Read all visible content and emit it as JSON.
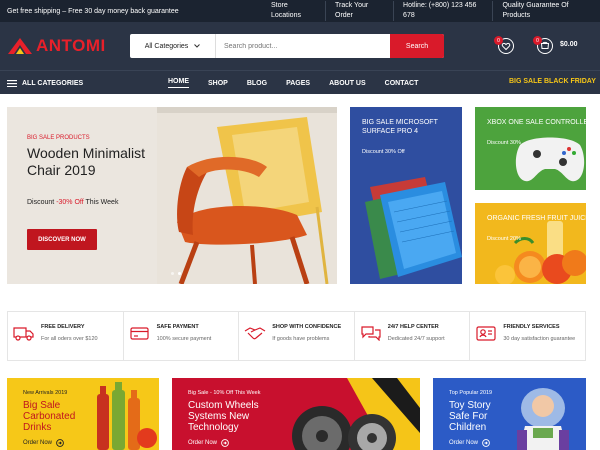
{
  "topbar": {
    "promo": "Get free shipping – Free 30 day money back guarantee",
    "links": [
      "Store Locations",
      "Track Your Order",
      "Hotline: (+800) 123 456 678",
      "Quality Guarantee Of Products"
    ]
  },
  "header": {
    "logo": "ANTOMI",
    "category": "All Categories",
    "search_placeholder": "Search product...",
    "search_button": "Search",
    "wishlist_count": "0",
    "cart_count": "0",
    "cart_total": "$0.00"
  },
  "nav": {
    "all_categories": "ALL CATEGORIES",
    "items": [
      "HOME",
      "SHOP",
      "BLOG",
      "PAGES",
      "ABOUT US",
      "CONTACT"
    ],
    "promo": "BIG SALE BLACK FRIDAY"
  },
  "hero": {
    "label": "BIG SALE PRODUCTS",
    "title": "Wooden Minimalist Chair 2019",
    "discount_prefix": "Discount",
    "discount_value": "-30% Off",
    "discount_suffix": "This Week",
    "button": "DISCOVER NOW"
  },
  "promos": [
    {
      "title": "BIG SALE MICROSOFT SURFACE PRO 4",
      "sub": "Discount 30% Off"
    },
    {
      "title": "XBOX ONE SALE CONTROLLER",
      "sub": "Discount 30%"
    },
    {
      "title": "ORGANIC FRESH FRUIT JUICE",
      "sub": "Discount 20%"
    }
  ],
  "features": [
    {
      "title": "FREE DELIVERY",
      "sub": "For all oders over $120"
    },
    {
      "title": "SAFE PAYMENT",
      "sub": "100% secure payment"
    },
    {
      "title": "SHOP WITH CONFIDENCE",
      "sub": "If goods have problems"
    },
    {
      "title": "24/7 HELP CENTER",
      "sub": "Dedicated 24/7 support"
    },
    {
      "title": "FRIENDLY SERVICES",
      "sub": "30 day satisfaction guarantee"
    }
  ],
  "banners": [
    {
      "sub": "New Arrivals 2019",
      "title": "Big Sale Carbonated Drinks",
      "link": "Order Now"
    },
    {
      "sub": "Big Sale - 10% Off This Week",
      "title": "Custom Wheels Systems New Technology",
      "link": "Order Now"
    },
    {
      "sub": "Top Popular 2019",
      "title": "Toy Story Safe For Children",
      "link": "Order Now"
    }
  ],
  "colors": {
    "accent": "#d91a2a",
    "dark": "#2b3445",
    "promo_yellow": "#f5c518"
  }
}
